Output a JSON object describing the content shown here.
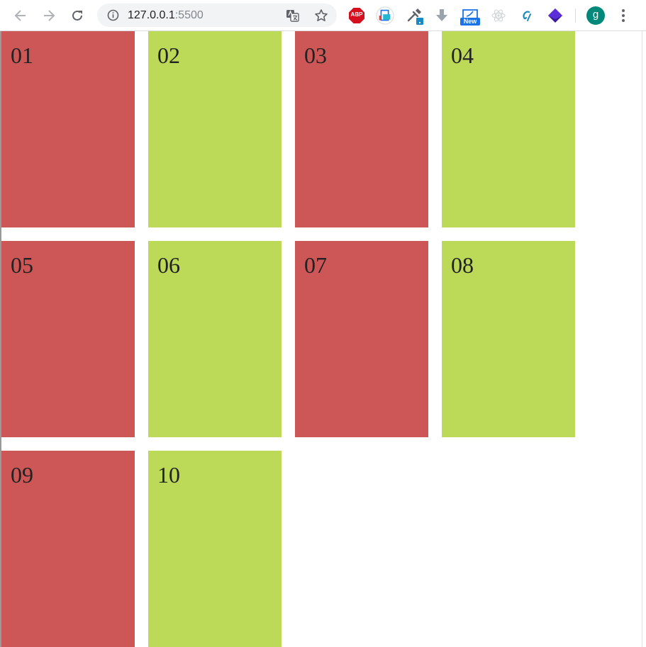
{
  "browser": {
    "url_host": "127.0.0.1",
    "url_port": ":5500",
    "icons": {
      "back": "arrow-left-icon",
      "forward": "arrow-right-icon",
      "reload": "reload-icon",
      "info": "info-icon",
      "translate": "translate-icon",
      "bookmark": "star-icon",
      "menu": "vertical-dots-icon"
    },
    "extensions": {
      "adblock_label": "ABP",
      "new_badge_label": "New"
    },
    "profile_initial": "g",
    "colors": {
      "profile_avatar": "#00897b",
      "adblock": "#d60f1e"
    }
  },
  "boxes": [
    {
      "label": "01",
      "color": "#cd5656"
    },
    {
      "label": "02",
      "color": "#bcd957"
    },
    {
      "label": "03",
      "color": "#cd5656"
    },
    {
      "label": "04",
      "color": "#bcd957"
    },
    {
      "label": "05",
      "color": "#cd5656"
    },
    {
      "label": "06",
      "color": "#bcd957"
    },
    {
      "label": "07",
      "color": "#cd5656"
    },
    {
      "label": "08",
      "color": "#bcd957"
    },
    {
      "label": "09",
      "color": "#cd5656"
    },
    {
      "label": "10",
      "color": "#bcd957"
    }
  ]
}
